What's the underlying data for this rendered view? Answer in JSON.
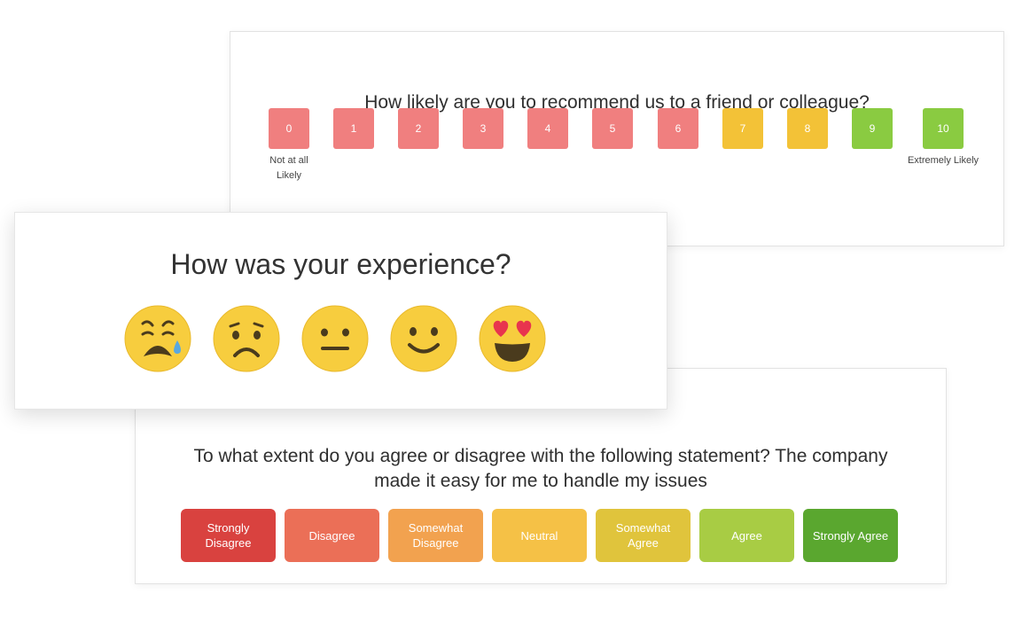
{
  "nps": {
    "question": "How likely are you to recommend us to a friend or colleague?",
    "options": [
      "0",
      "1",
      "2",
      "3",
      "4",
      "5",
      "6",
      "7",
      "8",
      "9",
      "10"
    ],
    "low_label": "Not at all Likely",
    "high_label": "Extremely Likely",
    "colors": {
      "low": "#f07f7f",
      "mid": "#f3c237",
      "high": "#8acb41"
    }
  },
  "experience": {
    "question": "How was your experience?",
    "emojis": [
      "crying-face-icon",
      "sad-face-icon",
      "neutral-face-icon",
      "smiling-face-icon",
      "heart-eyes-face-icon"
    ]
  },
  "likert": {
    "question": "To what extent do you agree or disagree with the following statement? The company made it easy for me to handle my issues",
    "options": [
      {
        "label": "Strongly Disagree",
        "color": "#d9423f"
      },
      {
        "label": "Disagree",
        "color": "#eb6f57"
      },
      {
        "label": "Somewhat Disagree",
        "color": "#f2a24f"
      },
      {
        "label": "Neutral",
        "color": "#f5c146"
      },
      {
        "label": "Somewhat Agree",
        "color": "#e0c43c"
      },
      {
        "label": "Agree",
        "color": "#a8cc44"
      },
      {
        "label": "Strongly Agree",
        "color": "#5aa72f"
      }
    ]
  }
}
